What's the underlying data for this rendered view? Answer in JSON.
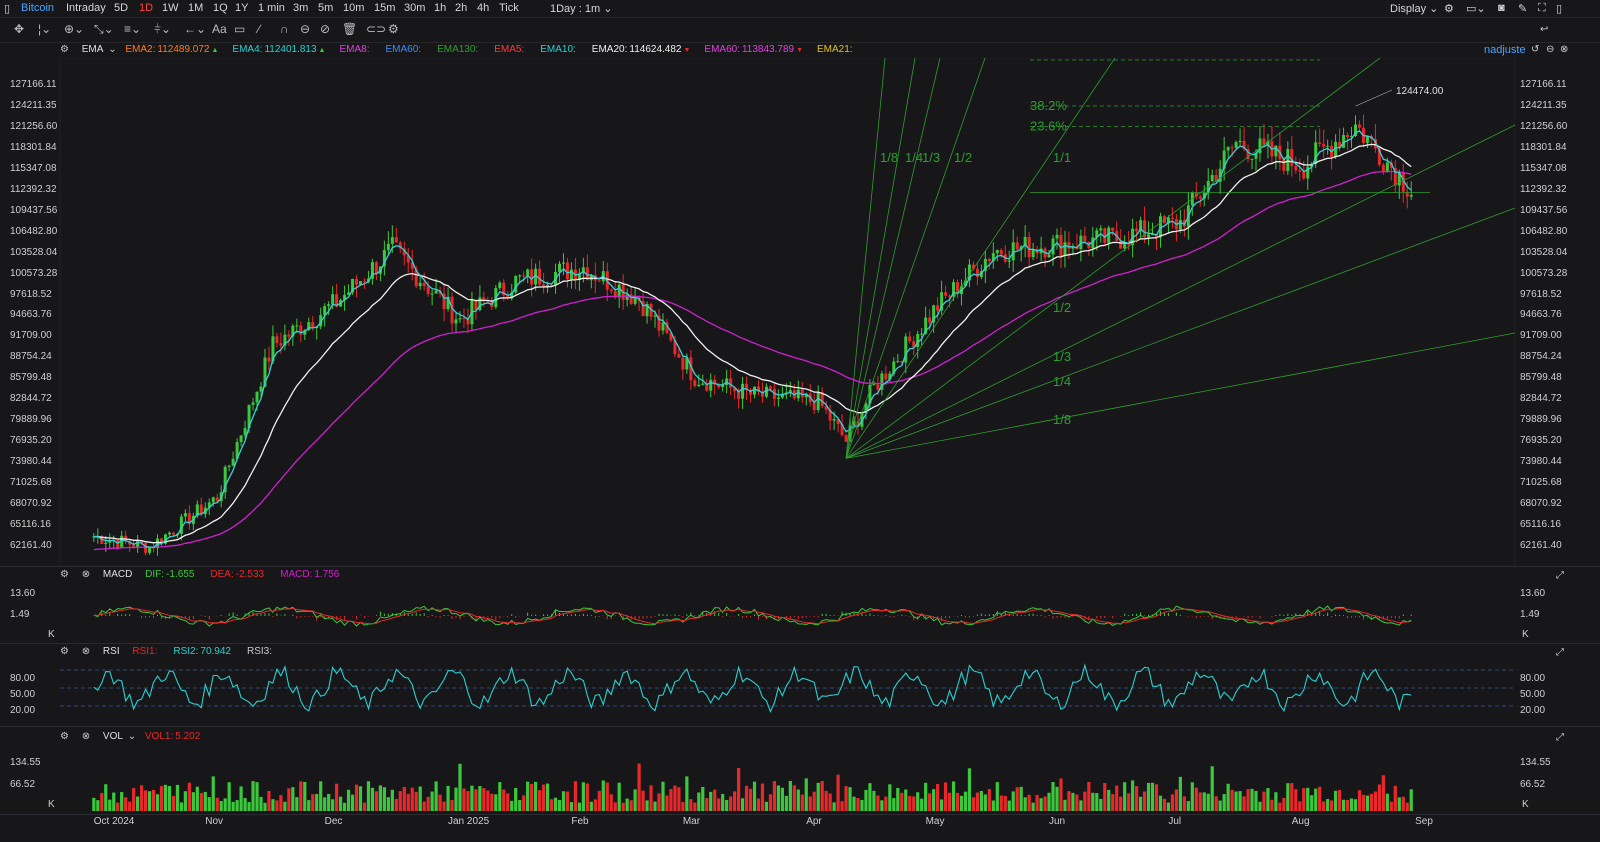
{
  "topbar": {
    "symbol": "Bitcoin",
    "intervals": [
      "Intraday",
      "5D",
      "1D",
      "1W",
      "1M",
      "1Q",
      "1Y",
      "1 min",
      "3m",
      "5m",
      "10m",
      "15m",
      "30m",
      "1h",
      "2h",
      "4h",
      "Tick"
    ],
    "active_interval": "1D",
    "period": "1Day : 1m",
    "display": "Display"
  },
  "colors": {
    "bg": "#17171a",
    "up": "#3cc83c",
    "down": "#e8282a",
    "ema_fast": "#3ad0d8",
    "ema_mid": "#f0f0f0",
    "ema_slow": "#d020d0",
    "fib": "#2e9e2e"
  },
  "main": {
    "indicator_name": "EMA",
    "legend": [
      {
        "label": "EMA2:",
        "value": "112489.072",
        "dir": "up",
        "color": "#ff7a1e"
      },
      {
        "label": "EMA4:",
        "value": "112401.813",
        "dir": "up",
        "color": "#2ad0d0"
      },
      {
        "label": "EMA8:",
        "value": "",
        "dir": "",
        "color": "#e040e0"
      },
      {
        "label": "EMA60:",
        "value": "",
        "dir": "",
        "color": "#3a8cff"
      },
      {
        "label": "EMA130:",
        "value": "",
        "dir": "",
        "color": "#2e9e2e"
      },
      {
        "label": "EMA5:",
        "value": "",
        "dir": "",
        "color": "#ff3a3a"
      },
      {
        "label": "EMA10:",
        "value": "",
        "dir": "",
        "color": "#2ad0d0"
      },
      {
        "label": "EMA20:",
        "value": "114624.482",
        "dir": "down",
        "color": "#f0f0f0"
      },
      {
        "label": "EMA60:",
        "value": "113843.789",
        "dir": "down",
        "color": "#e040e0"
      },
      {
        "label": "EMA21:",
        "value": "",
        "dir": "",
        "color": "#e0c020"
      }
    ],
    "adjust_label": "nadjuste",
    "price_ticks": [
      "127166.11",
      "124211.35",
      "121256.60",
      "118301.84",
      "115347.08",
      "112392.32",
      "109437.56",
      "106482.80",
      "103528.04",
      "100573.28",
      "97618.52",
      "94663.76",
      "91709.00",
      "88754.24",
      "85799.48",
      "82844.72",
      "79889.96",
      "76935.20",
      "73980.44",
      "71025.68",
      "68070.92",
      "65116.16",
      "62161.40"
    ],
    "high_marker": "124474.00",
    "fib_labels": [
      "38.2%",
      "23.6%"
    ],
    "fan_labels_top": [
      "1/8",
      "1/4",
      "1/3",
      "1/2",
      "1/1"
    ],
    "fan_labels_low": [
      "1/2",
      "1/3",
      "1/4",
      "1/8"
    ]
  },
  "macd": {
    "name": "MACD",
    "legend": [
      {
        "label": "DIF:",
        "value": "-1.655",
        "color": "#3cc83c"
      },
      {
        "label": "DEA:",
        "value": "-2.533",
        "color": "#e8282a"
      },
      {
        "label": "MACD:",
        "value": "1.756",
        "color": "#d020d0"
      }
    ],
    "ticks": [
      "13.60",
      "1.49",
      "K"
    ]
  },
  "rsi": {
    "name": "RSI",
    "legend": [
      {
        "label": "RSI1:",
        "value": "",
        "color": "#e8282a"
      },
      {
        "label": "RSI2:",
        "value": "70.942",
        "color": "#2ad0d0"
      },
      {
        "label": "RSI3:",
        "value": "",
        "color": "#c8c8c8"
      }
    ],
    "ticks": [
      "80.00",
      "50.00",
      "20.00"
    ]
  },
  "vol": {
    "name": "VOL",
    "legend": [
      {
        "label": "VOL1:",
        "value": "5.202",
        "color": "#e8282a"
      }
    ],
    "ticks": [
      "134.55",
      "66.52",
      "K"
    ]
  },
  "xaxis": [
    "Oct 2024",
    "Nov",
    "Dec",
    "Jan 2025",
    "Feb",
    "Mar",
    "Apr",
    "May",
    "Jun",
    "Jul",
    "Aug",
    "Sep"
  ],
  "chart_data": {
    "type": "candlestick",
    "title": "Bitcoin",
    "x": [
      "2024-10-01",
      "2024-10-15",
      "2024-11-01",
      "2024-11-15",
      "2024-12-01",
      "2024-12-15",
      "2025-01-01",
      "2025-01-15",
      "2025-02-01",
      "2025-02-15",
      "2025-03-01",
      "2025-03-15",
      "2025-04-01",
      "2025-04-08",
      "2025-04-15",
      "2025-05-01",
      "2025-05-15",
      "2025-06-01",
      "2025-06-15",
      "2025-07-01",
      "2025-07-15",
      "2025-08-01",
      "2025-08-14",
      "2025-08-28"
    ],
    "close": [
      63500,
      62000,
      69000,
      90500,
      96500,
      104000,
      94000,
      99500,
      101500,
      97000,
      86000,
      83500,
      82500,
      77000,
      84500,
      96000,
      103800,
      104800,
      105500,
      107800,
      119000,
      115800,
      121500,
      112400
    ],
    "ylim": [
      60000,
      128500
    ],
    "last_values": {
      "ema20": 114624.482,
      "ema60": 113843.789,
      "high": 124474.0
    }
  }
}
